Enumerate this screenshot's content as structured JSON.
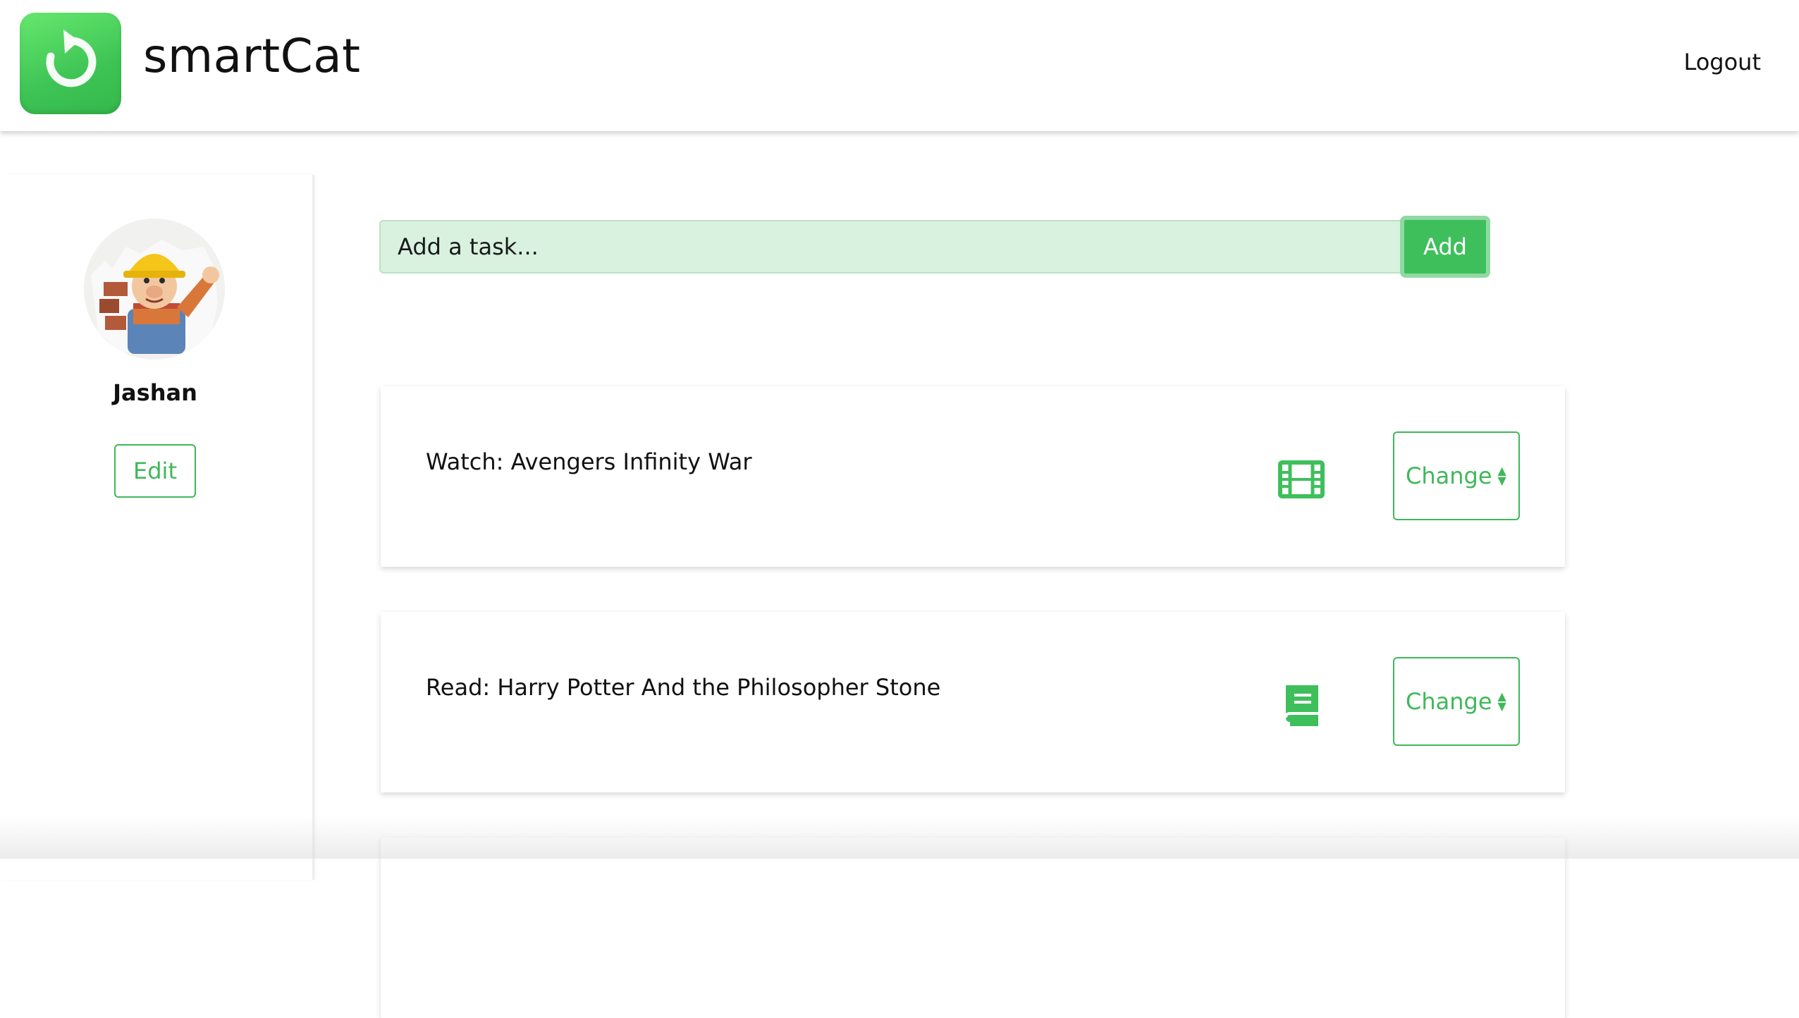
{
  "header": {
    "app_title": "smartCat",
    "logout_label": "Logout",
    "logo_icon": "refresh-arrow-icon",
    "brand_color": "#3fbf5c"
  },
  "profile": {
    "name": "Jashan",
    "edit_label": "Edit",
    "avatar_icon": "avatar-cartoon-builder"
  },
  "add_task": {
    "placeholder": "Add a task...",
    "button_label": "Add"
  },
  "tasks": [
    {
      "text": "Watch: Avengers Infinity War",
      "icon": "film-icon",
      "change_label": "Change",
      "arrows_icon": "sort-arrows-icon"
    },
    {
      "text": "Read: Harry Potter And the Philosopher Stone",
      "icon": "book-icon",
      "change_label": "Change",
      "arrows_icon": "sort-arrows-icon"
    }
  ]
}
